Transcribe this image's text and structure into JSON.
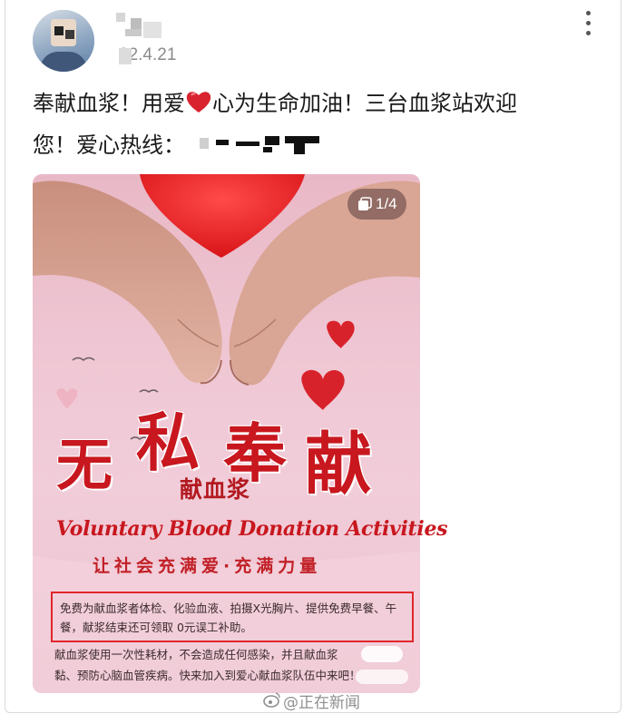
{
  "post": {
    "timestamp": "22.4.21",
    "text_line1_a": "奉献血浆！用爱",
    "text_line1_b": "心为生命加油！三台血浆站欢迎",
    "text_line2": "您！爱心热线：",
    "heart_emoji_color": "#d9232e"
  },
  "gallery": {
    "counter": "1/4",
    "counter_icon": "stack-icon"
  },
  "poster": {
    "title_chars": [
      "无",
      "私",
      "奉",
      "献"
    ],
    "subtitle": "献血浆",
    "english": "Voluntary Blood Donation Activities",
    "slogan": "让社会充满爱·充满力量",
    "boxed_text_line1": "免费为献血浆者体检、化验血液、拍摄X光胸片、提供免费早餐、午",
    "boxed_text_line2": "餐，献浆结束还可领取 0元误工补助。",
    "body_line1": "献血浆使用一次性耗材，不会造成任何感染，并且献血浆",
    "body_line2": "黏、预防心脑血管疾病。快来加入到爱心献血浆队伍中来吧！",
    "accent_color": "#c8171e",
    "highlight_box_color": "#e0262b"
  },
  "watermark": {
    "text": "@正在新闻",
    "icon": "weibo-icon"
  }
}
